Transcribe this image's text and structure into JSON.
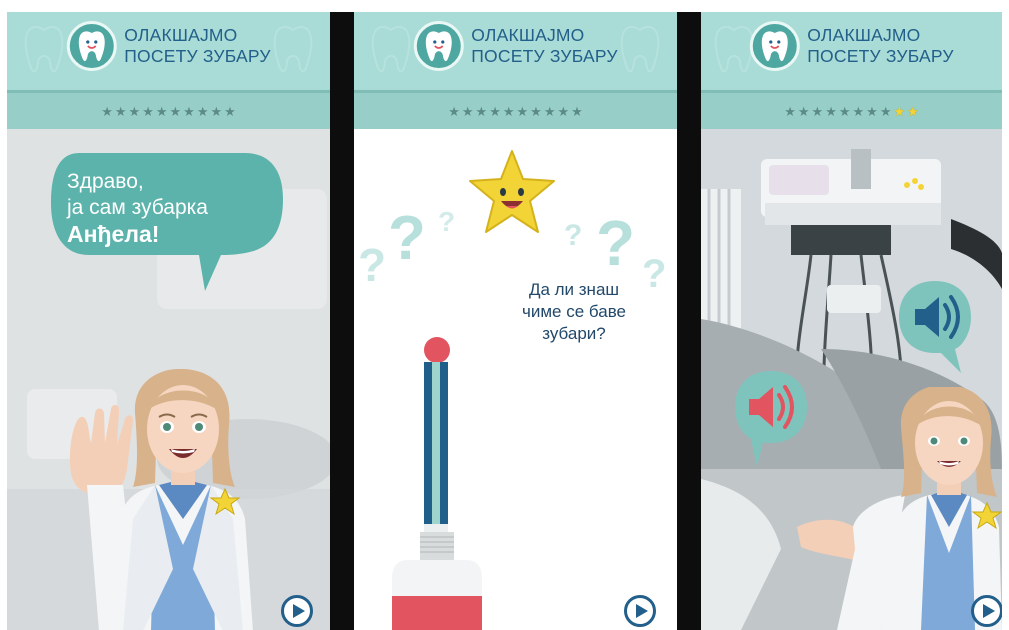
{
  "app": {
    "title_line1": "ОЛАКШАЈМО",
    "title_line2": "ПОСЕТУ ЗУБАРУ",
    "logo_icon": "tooth-icon"
  },
  "colors": {
    "header": "#a9dcd6",
    "brand_text": "#225f8a",
    "accent_teal": "#5bb3ab",
    "star_yellow": "#f3d437",
    "alert_red": "#e2545f"
  },
  "screens": [
    {
      "progress": {
        "total": 10,
        "filled": 0
      },
      "speech_line1": "Здраво,",
      "speech_line2": "ја сам зубарка",
      "speech_name": "Анђела!",
      "play_icon": "play-icon"
    },
    {
      "progress": {
        "total": 10,
        "filled": 0
      },
      "question_line1": "Да ли знаш",
      "question_line2": "чиме се баве",
      "question_line3": "зубари?",
      "play_icon": "play-icon"
    },
    {
      "progress": {
        "total": 10,
        "filled": 2
      },
      "sound_icons": [
        "speaker-icon",
        "speaker-icon"
      ],
      "play_icon": "play-icon"
    }
  ]
}
